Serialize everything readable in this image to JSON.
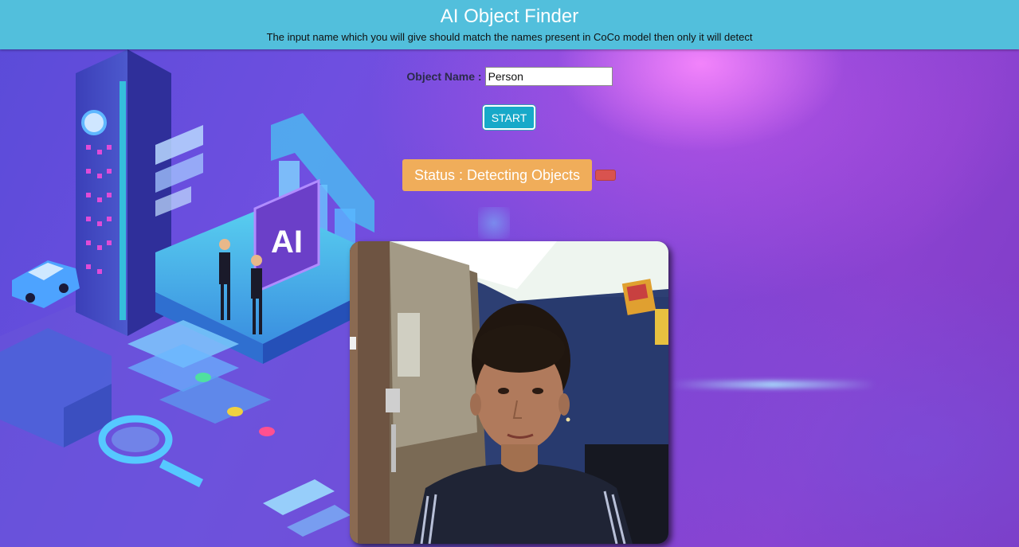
{
  "header": {
    "title": "AI Object Finder",
    "subtitle": "The input name which you will give should match the names present in CoCo model then only it will detect"
  },
  "form": {
    "object_label": "Object Name :",
    "object_value": "Person",
    "start_label": "START"
  },
  "status": {
    "text": "Status : Detecting Objects"
  },
  "background": {
    "scene_text": "AI"
  },
  "colors": {
    "header_bg": "#52bfdc",
    "start_button": "#17a9c9",
    "status_bg": "#f0ad5a",
    "stop_button": "#d9534f"
  },
  "icons": [
    "stop-icon"
  ]
}
